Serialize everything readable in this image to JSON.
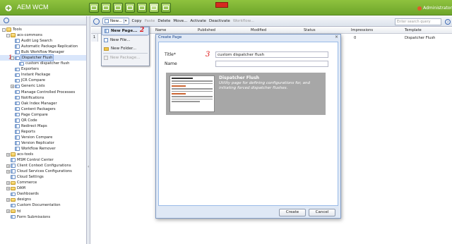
{
  "app": {
    "title": "AEM WCM",
    "user": "Administrator"
  },
  "topbar": {
    "badge": ""
  },
  "left_tree": {
    "items": [
      {
        "label": "Tools",
        "indent": 0,
        "expander": "-",
        "icon": "folder"
      },
      {
        "label": "acs-commons",
        "indent": 1,
        "expander": "-",
        "icon": "folder"
      },
      {
        "label": "Audit Log Search",
        "indent": 2,
        "expander": "",
        "icon": "page"
      },
      {
        "label": "Automatic Package Replication",
        "indent": 2,
        "expander": "",
        "icon": "page"
      },
      {
        "label": "Bulk Workflow Manager",
        "indent": 2,
        "expander": "",
        "icon": "page"
      },
      {
        "label": "Dispatcher Flush",
        "indent": 2,
        "expander": "-",
        "icon": "page",
        "selected": true
      },
      {
        "label": "custom dispatcher flush",
        "indent": 3,
        "expander": "",
        "icon": "page"
      },
      {
        "label": "Exporters",
        "indent": 2,
        "expander": "",
        "icon": "page"
      },
      {
        "label": "Instant Package",
        "indent": 2,
        "expander": "",
        "icon": "page"
      },
      {
        "label": "JCR Compare",
        "indent": 2,
        "expander": "",
        "icon": "page"
      },
      {
        "label": "Generic Lists",
        "indent": 2,
        "expander": "+",
        "icon": "page"
      },
      {
        "label": "Manage Controlled Processes",
        "indent": 2,
        "expander": "",
        "icon": "page"
      },
      {
        "label": "Notifications",
        "indent": 2,
        "expander": "",
        "icon": "page"
      },
      {
        "label": "Oak Index Manager",
        "indent": 2,
        "expander": "",
        "icon": "page"
      },
      {
        "label": "Content Packagers",
        "indent": 2,
        "expander": "",
        "icon": "page"
      },
      {
        "label": "Page Compare",
        "indent": 2,
        "expander": "",
        "icon": "page"
      },
      {
        "label": "QR Code",
        "indent": 2,
        "expander": "",
        "icon": "page"
      },
      {
        "label": "Redirect Maps",
        "indent": 2,
        "expander": "",
        "icon": "page"
      },
      {
        "label": "Reports",
        "indent": 2,
        "expander": "",
        "icon": "page"
      },
      {
        "label": "Version Compare",
        "indent": 2,
        "expander": "",
        "icon": "page"
      },
      {
        "label": "Version Replicator",
        "indent": 2,
        "expander": "",
        "icon": "page"
      },
      {
        "label": "Workflow Remover",
        "indent": 2,
        "expander": "",
        "icon": "page"
      },
      {
        "label": "acs-tools",
        "indent": 1,
        "expander": "+",
        "icon": "folder"
      },
      {
        "label": "MSM Control Center",
        "indent": 1,
        "expander": "",
        "icon": "page"
      },
      {
        "label": "Client Context Configurations",
        "indent": 1,
        "expander": "+",
        "icon": "page"
      },
      {
        "label": "Cloud Services Configurations",
        "indent": 1,
        "expander": "+",
        "icon": "page"
      },
      {
        "label": "Cloud Settings",
        "indent": 1,
        "expander": "",
        "icon": "page"
      },
      {
        "label": "Commerce",
        "indent": 1,
        "expander": "+",
        "icon": "folder"
      },
      {
        "label": "DAM",
        "indent": 1,
        "expander": "+",
        "icon": "folder"
      },
      {
        "label": "Dashboards",
        "indent": 1,
        "expander": "",
        "icon": "page"
      },
      {
        "label": "designs",
        "indent": 1,
        "expander": "+",
        "icon": "folder"
      },
      {
        "label": "Custom Documentation",
        "indent": 1,
        "expander": "",
        "icon": "page"
      },
      {
        "label": "fd",
        "indent": 1,
        "expander": "+",
        "icon": "folder"
      },
      {
        "label": "Form Submissions",
        "indent": 1,
        "expander": "",
        "icon": "page"
      }
    ]
  },
  "toolbar": {
    "new_label": "New...",
    "copy": "Copy",
    "paste": "Paste",
    "delete": "Delete",
    "move": "Move...",
    "activate": "Activate",
    "deactivate": "Deactivate",
    "workflow": "Workflow...",
    "search_placeholder": "Enter search query"
  },
  "grid": {
    "columns": [
      "Name",
      "Published",
      "Modified",
      "Status",
      "Impressions",
      "Template"
    ],
    "row": {
      "num": "1",
      "impressions": "0",
      "template": "Dispatcher Flush"
    }
  },
  "menu": {
    "items": [
      {
        "label": "New Page...",
        "disabled": false
      },
      {
        "label": "New File...",
        "disabled": false
      },
      {
        "label": "New Folder...",
        "disabled": false
      },
      {
        "label": "New Package...",
        "disabled": true
      }
    ]
  },
  "dialog": {
    "title": "Create Page",
    "title_label": "Title*",
    "title_value": "custom dispatcher flush",
    "name_label": "Name",
    "name_value": "",
    "template": {
      "name": "Dispatcher Flush",
      "description": "Utility page for defining configurations for, and initiating forced dispatcher flushes."
    },
    "create_label": "Create",
    "cancel_label": "Cancel"
  },
  "annotations": {
    "one": "1",
    "two": "2",
    "three": "3"
  }
}
